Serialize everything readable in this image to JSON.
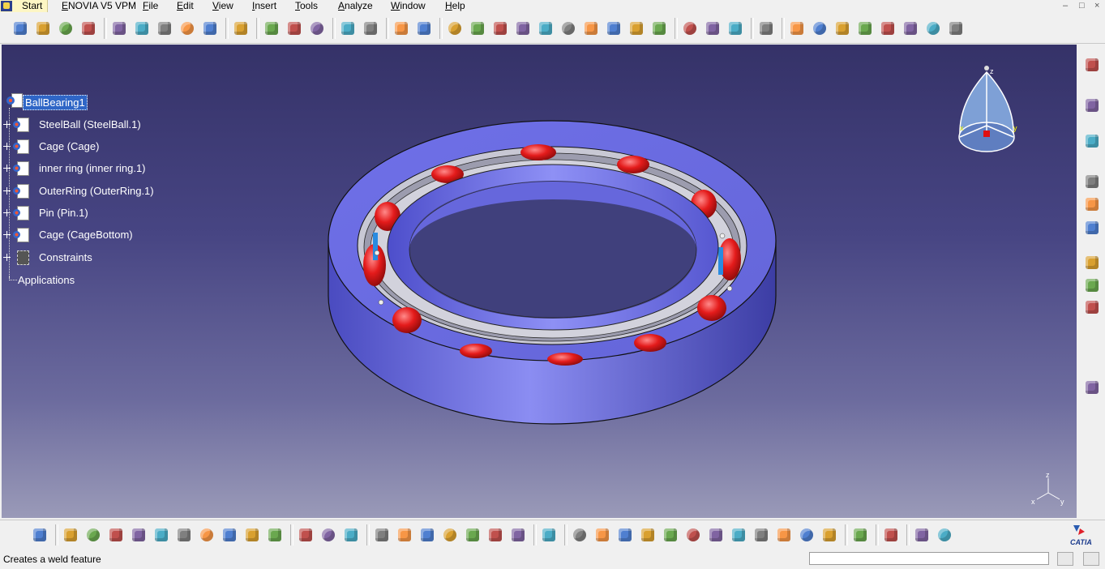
{
  "menu": {
    "items": [
      "Start",
      "ENOVIA V5 VPM",
      "File",
      "Edit",
      "View",
      "Insert",
      "Tools",
      "Analyze",
      "Window",
      "Help"
    ],
    "window_controls": [
      "–",
      "□",
      "×"
    ]
  },
  "tree": {
    "root": "BallBearing1",
    "children": [
      "SteelBall (SteelBall.1)",
      "Cage (Cage)",
      "inner ring (inner ring.1)",
      "OuterRing (OuterRing.1)",
      "Pin (Pin.1)",
      "Cage (CageBottom)",
      "Constraints"
    ],
    "applications": "Applications"
  },
  "compass": {
    "axis_labels": [
      "z",
      "x",
      "y"
    ]
  },
  "axis_triad": {
    "labels": [
      "z",
      "x",
      "y"
    ]
  },
  "brand": {
    "logo_text": "CATIA"
  },
  "status": {
    "message": "Creates a weld feature",
    "command_input_value": "",
    "command_input_placeholder": ""
  },
  "colors": {
    "viewport_top": "#353268",
    "viewport_bottom": "#9a9ab8",
    "part_body": "#6a6be0",
    "ball": "#e41b1b",
    "selection": "#2f66c6"
  },
  "icons": {
    "top_toolbar": [
      "product-icon",
      "component-icon",
      "part-icon",
      "existing-component-icon",
      "measure-icon",
      "annotation-icon",
      "snap-icon",
      "fastening-icon",
      "sketch-icon",
      "catalog-icon",
      "point-icon",
      "arc-icon",
      "surface-icon",
      "offset-icon",
      "explode-icon",
      "manipulate-icon",
      "assembly-icon",
      "body-icon",
      "clash-icon",
      "constraint-icon",
      "section-icon",
      "weld-icon",
      "scene-icon",
      "update-icon",
      "replace-icon",
      "tolerance-icon",
      "render-icon",
      "simulation-icon",
      "settings-icon",
      "mirror-icon",
      "texture-icon",
      "material-icon",
      "parameters-icon",
      "formula-icon",
      "rule-icon",
      "check-icon",
      "export-icon",
      "import-icon",
      "text-icon"
    ],
    "bottom_toolbar": [
      "workbench-icon",
      "new-icon",
      "open-icon",
      "save-icon",
      "print-icon",
      "cut-icon",
      "copy-icon",
      "paste-icon",
      "undo-icon",
      "redo-icon",
      "whats-this-icon",
      "measure-icon",
      "catalog-icon",
      "library-icon",
      "formula-icon",
      "comment-icon",
      "light-icon",
      "table-icon",
      "graph-icon",
      "lock-icon",
      "macro-icon",
      "capture-icon",
      "fly-icon",
      "fit-all-icon",
      "pan-icon",
      "rotate-icon",
      "zoom-in-icon",
      "zoom-out-icon",
      "normal-view-icon",
      "multi-view-icon",
      "iso-view-icon",
      "shading-icon",
      "hide-show-icon",
      "swap-visible-icon",
      "refresh-icon",
      "network-icon",
      "disconnect-icon",
      "next-icon"
    ]
  }
}
